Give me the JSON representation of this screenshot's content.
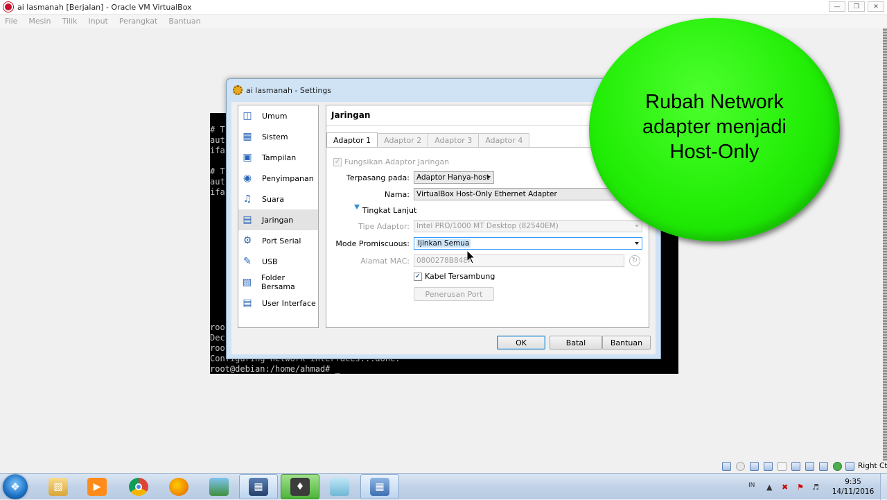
{
  "window": {
    "title": "ai lasmanah [Berjalan] - Oracle VM VirtualBox",
    "controls": [
      "minimize",
      "restore",
      "close"
    ]
  },
  "menubar": [
    "File",
    "Mesin",
    "Tilik",
    "Input",
    "Perangkat",
    "Bantuan"
  ],
  "terminal": {
    "lines_top": [
      "# T",
      "aut",
      "ifa",
      "",
      "# T",
      "aut",
      "ifa"
    ],
    "lines_bottom": [
      "roo",
      "Dec",
      "roo",
      "Configuring network interfaces...done.",
      "root@debian:/home/ahmad# _"
    ]
  },
  "dialog": {
    "title": "ai lasmanah - Settings",
    "categories": [
      {
        "label": "Umum",
        "icon": "general-icon"
      },
      {
        "label": "Sistem",
        "icon": "system-icon"
      },
      {
        "label": "Tampilan",
        "icon": "display-icon"
      },
      {
        "label": "Penyimpanan",
        "icon": "storage-icon"
      },
      {
        "label": "Suara",
        "icon": "audio-icon"
      },
      {
        "label": "Jaringan",
        "icon": "network-icon",
        "selected": true
      },
      {
        "label": "Port Serial",
        "icon": "serial-port-icon"
      },
      {
        "label": "USB",
        "icon": "usb-icon"
      },
      {
        "label": "Folder Bersama",
        "icon": "shared-folder-icon"
      },
      {
        "label": "User Interface",
        "icon": "user-interface-icon"
      }
    ],
    "panel_title": "Jaringan",
    "tabs": [
      "Adaptor 1",
      "Adaptor 2",
      "Adaptor 3",
      "Adaptor 4"
    ],
    "active_tab": 0,
    "enable_adapter": {
      "label": "Fungsikan Adaptor Jaringan",
      "checked": true
    },
    "attached_to": {
      "label": "Terpasang pada:",
      "value": "Adaptor Hanya-host"
    },
    "name": {
      "label": "Nama:",
      "value": "VirtualBox Host-Only Ethernet Adapter"
    },
    "advanced": {
      "label": "Tingkat Lanjut"
    },
    "adapter_type": {
      "label": "Tipe Adaptor:",
      "value": "Intel PRO/1000 MT Desktop (82540EM)"
    },
    "promiscuous": {
      "label": "Mode Promiscuous:",
      "value": "Ijinkan Semua"
    },
    "mac": {
      "label": "Alamat MAC:",
      "value": "0800278B848A"
    },
    "cable": {
      "label": "Kabel Tersambung",
      "checked": true
    },
    "port_forward": "Penerusan Port",
    "buttons": {
      "ok": "OK",
      "cancel": "Batal",
      "help": "Bantuan"
    }
  },
  "annotation": {
    "text": "Rubah Network\nadapter menjadi\nHost-Only",
    "color": "#22ee06"
  },
  "statusbar": {
    "host_key": "Right Ctrl"
  },
  "taskbar": {
    "apps": [
      "windows-explorer-icon",
      "media-player-icon",
      "chrome-icon",
      "firefox-icon",
      "photo-icon",
      "virtualbox-icon",
      "green-app-icon",
      "notepad-icon",
      "control-panel-icon"
    ],
    "language": "IN",
    "time": "9:35",
    "date": "14/11/2016"
  }
}
